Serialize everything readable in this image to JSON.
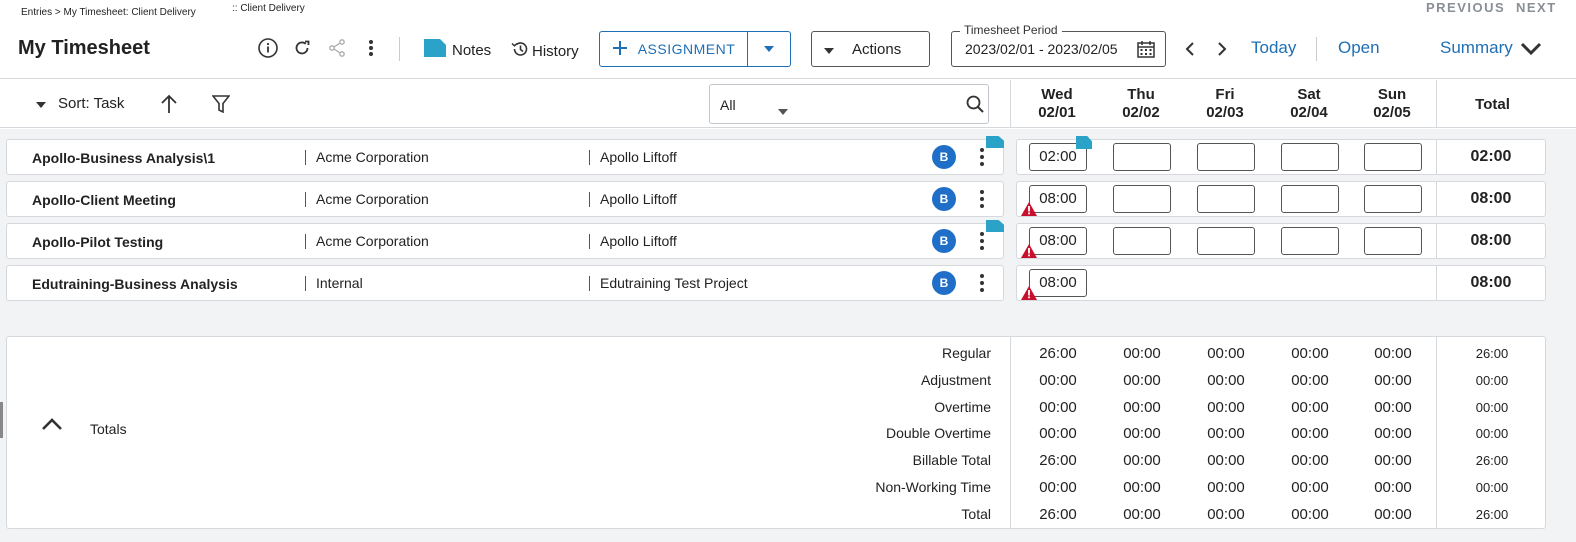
{
  "breadcrumb": {
    "path": "Entries > My Timesheet: Client Delivery",
    "extra": ":: Client Delivery"
  },
  "topnav": {
    "previous": "PREVIOUS",
    "next": "NEXT"
  },
  "page_title": "My Timesheet",
  "toolbar": {
    "notes_label": "Notes",
    "history_label": "History",
    "assignment_label": "ASSIGNMENT",
    "actions_label": "Actions",
    "period_label": "Timesheet Period",
    "period_value": "2023/02/01 - 2023/02/05",
    "today_label": "Today",
    "status_label": "Open",
    "summary_label": "Summary"
  },
  "grid_toolbar": {
    "sort_label": "Sort: Task",
    "filter_value": "All"
  },
  "days": [
    {
      "dow": "Wed",
      "date": "02/01"
    },
    {
      "dow": "Thu",
      "date": "02/02"
    },
    {
      "dow": "Fri",
      "date": "02/03"
    },
    {
      "dow": "Sat",
      "date": "02/04"
    },
    {
      "dow": "Sun",
      "date": "02/05"
    }
  ],
  "total_header": "Total",
  "rows": [
    {
      "task": "Apollo-Business Analysis\\1",
      "client": "Acme Corporation",
      "project": "Apollo Liftoff",
      "badge": "B",
      "hours": [
        "02:00",
        "",
        "",
        "",
        ""
      ],
      "total": "02:00",
      "has_note": true,
      "warning": false
    },
    {
      "task": "Apollo-Client Meeting",
      "client": "Acme Corporation",
      "project": "Apollo Liftoff",
      "badge": "B",
      "hours": [
        "08:00",
        "",
        "",
        "",
        ""
      ],
      "total": "08:00",
      "has_note": false,
      "warning": true
    },
    {
      "task": "Apollo-Pilot Testing",
      "client": "Acme Corporation",
      "project": "Apollo Liftoff",
      "badge": "B",
      "hours": [
        "08:00",
        "",
        "",
        "",
        ""
      ],
      "total": "08:00",
      "has_note": true,
      "warning": true
    },
    {
      "task": "Edutraining-Business Analysis",
      "client": "Internal",
      "project": "Edutraining Test Project",
      "badge": "B",
      "hours": [
        "08:00"
      ],
      "total": "08:00",
      "has_note": false,
      "warning": true
    }
  ],
  "totals": {
    "label": "Totals",
    "lines": [
      {
        "label": "Regular",
        "values": [
          "26:00",
          "00:00",
          "00:00",
          "00:00",
          "00:00"
        ],
        "total": "26:00"
      },
      {
        "label": "Adjustment",
        "values": [
          "00:00",
          "00:00",
          "00:00",
          "00:00",
          "00:00"
        ],
        "total": "00:00"
      },
      {
        "label": "Overtime",
        "values": [
          "00:00",
          "00:00",
          "00:00",
          "00:00",
          "00:00"
        ],
        "total": "00:00"
      },
      {
        "label": "Double Overtime",
        "values": [
          "00:00",
          "00:00",
          "00:00",
          "00:00",
          "00:00"
        ],
        "total": "00:00"
      },
      {
        "label": "Billable Total",
        "values": [
          "26:00",
          "00:00",
          "00:00",
          "00:00",
          "00:00"
        ],
        "total": "26:00"
      },
      {
        "label": "Non-Working Time",
        "values": [
          "00:00",
          "00:00",
          "00:00",
          "00:00",
          "00:00"
        ],
        "total": "00:00"
      },
      {
        "label": "Total",
        "values": [
          "26:00",
          "00:00",
          "00:00",
          "00:00",
          "00:00"
        ],
        "total": "26:00"
      }
    ]
  },
  "colors": {
    "accent": "#1f6fb5",
    "note": "#2ba2c7",
    "warning": "#c8102e",
    "badge": "#1f6fc9"
  }
}
